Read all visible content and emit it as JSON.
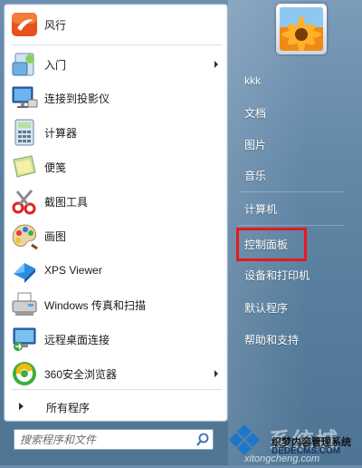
{
  "programs": [
    {
      "label": "风行",
      "icon": "fengxing-icon",
      "has_arrow": false
    },
    {
      "label": "入门",
      "icon": "getting-started-icon",
      "has_arrow": true
    },
    {
      "label": "连接到投影仪",
      "icon": "projector-icon",
      "has_arrow": false
    },
    {
      "label": "计算器",
      "icon": "calculator-icon",
      "has_arrow": false
    },
    {
      "label": "便笺",
      "icon": "sticky-notes-icon",
      "has_arrow": false
    },
    {
      "label": "截图工具",
      "icon": "scissors-icon",
      "has_arrow": false
    },
    {
      "label": "画图",
      "icon": "paint-palette-icon",
      "has_arrow": false
    },
    {
      "label": "XPS Viewer",
      "icon": "xps-viewer-icon",
      "has_arrow": false
    },
    {
      "label": "Windows 传真和扫描",
      "icon": "fax-scanner-icon",
      "has_arrow": false
    },
    {
      "label": "远程桌面连接",
      "icon": "remote-desktop-icon",
      "has_arrow": false
    },
    {
      "label": "360安全浏览器",
      "icon": "360-browser-icon",
      "has_arrow": true
    }
  ],
  "all_programs_label": "所有程序",
  "search": {
    "placeholder": "搜索程序和文件"
  },
  "right_menu": {
    "user": "kkk",
    "items": [
      "文档",
      "图片",
      "音乐",
      "计算机",
      "控制面板",
      "设备和打印机",
      "默认程序",
      "帮助和支持"
    ],
    "highlighted": "控制面板",
    "highlight_color": "#e6191e"
  },
  "watermark": {
    "brand": "系统城",
    "line1": "织梦内容管理系统",
    "line2": "DEDECMS.COM",
    "line3": "xitongcheng.com"
  }
}
